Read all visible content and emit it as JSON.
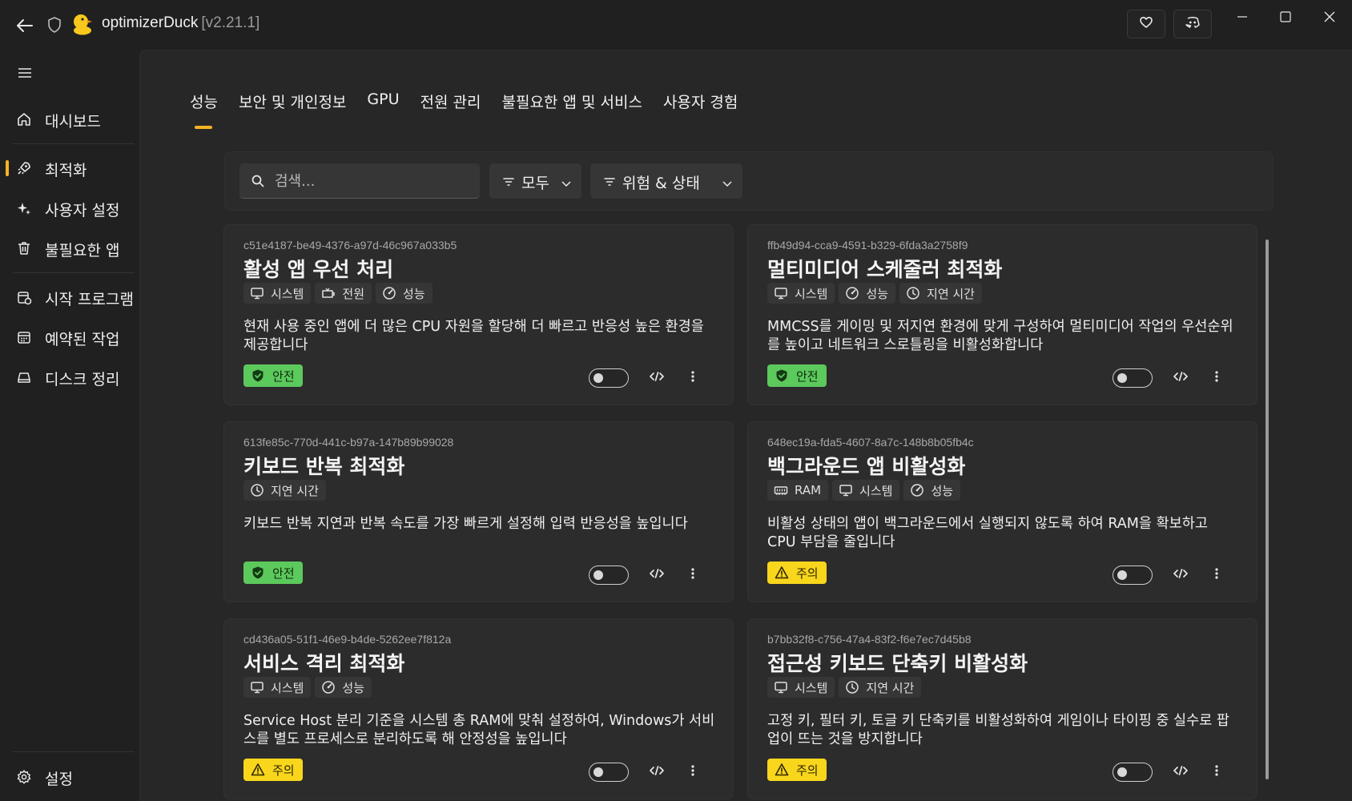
{
  "app": {
    "name": "optimizerDuck",
    "version": "[v2.21.1]",
    "accent": "#f4b324"
  },
  "sidebar": {
    "items": [
      {
        "label": "대시보드",
        "icon": "home-icon"
      },
      {
        "label": "최적화",
        "icon": "rocket-icon",
        "active": true
      },
      {
        "label": "사용자 설정",
        "icon": "sparkle-icon"
      },
      {
        "label": "불필요한 앱",
        "icon": "trash-icon"
      },
      {
        "label": "시작 프로그램",
        "icon": "startup-icon"
      },
      {
        "label": "예약된 작업",
        "icon": "calendar-icon"
      },
      {
        "label": "디스크 정리",
        "icon": "drive-icon"
      }
    ],
    "settings_label": "설정"
  },
  "tabs": [
    "성능",
    "보안 및 개인정보",
    "GPU",
    "전원 관리",
    "불필요한 앱 및 서비스",
    "사용자 경험"
  ],
  "filters": {
    "search_placeholder": "검색...",
    "category": "모두",
    "risk": "위험 & 상태"
  },
  "badges": {
    "safe": "안전",
    "warn": "주의",
    "safe_color": "#5cc95c",
    "warn_color": "#f8d61c"
  },
  "cards": [
    {
      "uuid": "c51e4187-be49-4376-a97d-46c967a033b5",
      "title": "활성 앱 우선 처리",
      "tags": [
        {
          "label": "시스템",
          "icon": "monitor-icon"
        },
        {
          "label": "전원",
          "icon": "battery-icon"
        },
        {
          "label": "성능",
          "icon": "gauge-icon"
        }
      ],
      "description": "현재 사용 중인 앱에 더 많은 CPU 자원을 할당해 더 빠르고 반응성 높은 환경을 제공합니다",
      "risk": "안전",
      "enabled": false
    },
    {
      "uuid": "ffb49d94-cca9-4591-b329-6fda3a2758f9",
      "title": "멀티미디어 스케줄러 최적화",
      "tags": [
        {
          "label": "시스템",
          "icon": "monitor-icon"
        },
        {
          "label": "성능",
          "icon": "gauge-icon"
        },
        {
          "label": "지연 시간",
          "icon": "clock-icon"
        }
      ],
      "description": "MMCSS를 게이밍 및 저지연 환경에 맞게 구성하여 멀티미디어 작업의 우선순위를 높이고 네트워크 스로틀링을 비활성화합니다",
      "risk": "안전",
      "enabled": false
    },
    {
      "uuid": "613fe85c-770d-441c-b97a-147b89b99028",
      "title": "키보드 반복 최적화",
      "tags": [
        {
          "label": "지연 시간",
          "icon": "clock-icon"
        }
      ],
      "description": "키보드 반복 지연과 반복 속도를 가장 빠르게 설정해 입력 반응성을 높입니다",
      "risk": "안전",
      "enabled": false
    },
    {
      "uuid": "648ec19a-fda5-4607-8a7c-148b8b05fb4c",
      "title": "백그라운드 앱 비활성화",
      "tags": [
        {
          "label": "RAM",
          "icon": "ram-icon"
        },
        {
          "label": "시스템",
          "icon": "monitor-icon"
        },
        {
          "label": "성능",
          "icon": "gauge-icon"
        }
      ],
      "description": "비활성 상태의 앱이 백그라운드에서 실행되지 않도록 하여 RAM을 확보하고 CPU 부담을 줄입니다",
      "risk": "주의",
      "enabled": false
    },
    {
      "uuid": "cd436a05-51f1-46e9-b4de-5262ee7f812a",
      "title": "서비스 격리 최적화",
      "tags": [
        {
          "label": "시스템",
          "icon": "monitor-icon"
        },
        {
          "label": "성능",
          "icon": "gauge-icon"
        }
      ],
      "description": "Service Host 분리 기준을 시스템 총 RAM에 맞춰 설정하여, Windows가 서비스를 별도 프로세스로 분리하도록 해 안정성을 높입니다",
      "risk": "주의",
      "enabled": false
    },
    {
      "uuid": "b7bb32f8-c756-47a4-83f2-f6e7ec7d45b8",
      "title": "접근성 키보드 단축키 비활성화",
      "tags": [
        {
          "label": "시스템",
          "icon": "monitor-icon"
        },
        {
          "label": "지연 시간",
          "icon": "clock-icon"
        }
      ],
      "description": "고정 키, 필터 키, 토글 키 단축키를 비활성화하여 게임이나 타이핑 중 실수로 팝업이 뜨는 것을 방지합니다",
      "risk": "주의",
      "enabled": false
    }
  ]
}
